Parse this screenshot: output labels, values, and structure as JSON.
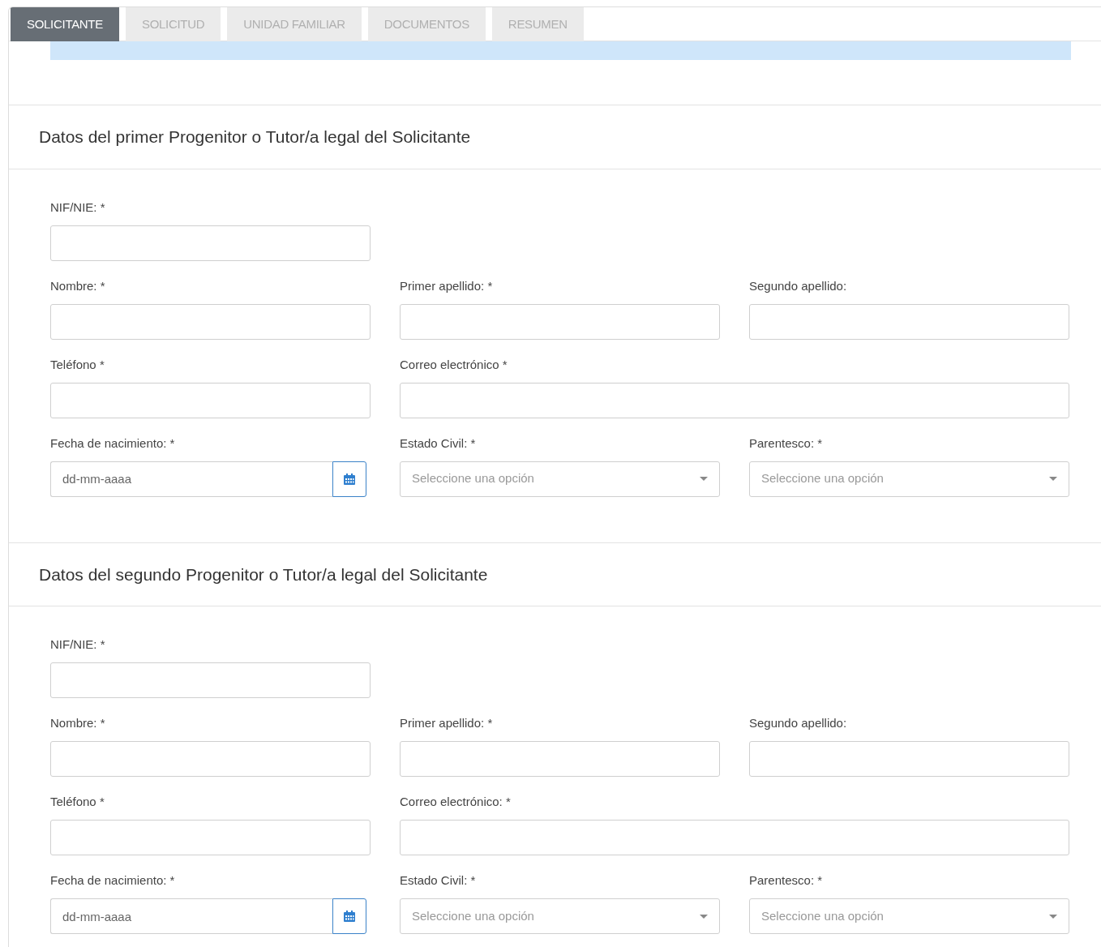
{
  "tabs": [
    {
      "label": "SOLICITANTE",
      "selected": true
    },
    {
      "label": "SOLICITUD",
      "selected": false
    },
    {
      "label": "UNIDAD FAMILIAR",
      "selected": false
    },
    {
      "label": "DOCUMENTOS",
      "selected": false
    },
    {
      "label": "RESUMEN",
      "selected": false
    }
  ],
  "sections": [
    {
      "title": "Datos del primer Progenitor o Tutor/a legal del Solicitante",
      "rows": [
        [
          {
            "label": "NIF/NIE: *",
            "kind": "text"
          }
        ],
        [
          {
            "label": "Nombre: *",
            "kind": "text"
          },
          {
            "label": "Primer apellido: *",
            "kind": "text"
          },
          {
            "label": "Segundo apellido:",
            "kind": "text"
          }
        ],
        [
          {
            "label": "Teléfono *",
            "kind": "text"
          },
          {
            "label": "Correo electrónico *",
            "kind": "wide"
          }
        ],
        [
          {
            "label": "Fecha de nacimiento: *",
            "kind": "date",
            "placeholder": "dd-mm-aaaa"
          },
          {
            "label": "Estado Civil: *",
            "kind": "select",
            "placeholder": "Seleccione una opción"
          },
          {
            "label": "Parentesco: *",
            "kind": "select",
            "placeholder": "Seleccione una opción"
          }
        ]
      ]
    },
    {
      "title": "Datos del segundo Progenitor o Tutor/a legal del Solicitante",
      "rows": [
        [
          {
            "label": "NIF/NIE: *",
            "kind": "text"
          }
        ],
        [
          {
            "label": "Nombre: *",
            "kind": "text"
          },
          {
            "label": "Primer apellido: *",
            "kind": "text"
          },
          {
            "label": "Segundo apellido:",
            "kind": "text"
          }
        ],
        [
          {
            "label": "Teléfono *",
            "kind": "text"
          },
          {
            "label": "Correo electrónico: *",
            "kind": "wide"
          }
        ],
        [
          {
            "label": "Fecha de nacimiento: *",
            "kind": "date",
            "placeholder": "dd-mm-aaaa"
          },
          {
            "label": "Estado Civil: *",
            "kind": "select",
            "placeholder": "Seleccione una opción"
          },
          {
            "label": "Parentesco: *",
            "kind": "select",
            "placeholder": "Seleccione una opción"
          }
        ]
      ]
    }
  ]
}
